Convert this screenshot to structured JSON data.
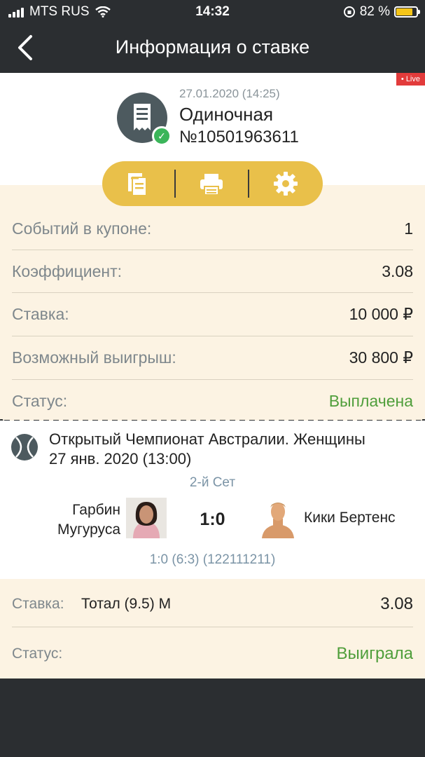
{
  "status_bar": {
    "carrier": "MTS RUS",
    "time": "14:32",
    "battery_percent": "82 %"
  },
  "navbar": {
    "back_icon": "chevron-left-icon",
    "title": "Информация о ставке"
  },
  "bet_header": {
    "live_badge": "• Live",
    "date": "27.01.2020 (14:25)",
    "type": "Одиночная",
    "number": "№10501963611",
    "icon": "receipt-icon",
    "status_icon": "check-circle-icon"
  },
  "toolbar": {
    "icons": [
      "document-copy-icon",
      "printer-icon",
      "gear-icon"
    ]
  },
  "summary": {
    "rows": [
      {
        "label": "Событий в купоне:",
        "value": "1"
      },
      {
        "label": "Коэффициент:",
        "value": "3.08"
      },
      {
        "label": "Ставка:",
        "value": "10 000 ₽"
      },
      {
        "label": "Возможный выигрыш:",
        "value": "30 800 ₽"
      },
      {
        "label": "Статус:",
        "value": "Выплачена"
      }
    ]
  },
  "event": {
    "sport_icon": "tennis-ball-icon",
    "tournament": "Открытый Чемпионат Австралии. Женщины",
    "date": "27 янв. 2020 (13:00)",
    "period": "2-й Сет",
    "team1_line1": "Гарбин",
    "team1_line2": "Мугуруса",
    "score": "1:0",
    "team2": "Кики Бертенс",
    "detail": "1:0 (6:3) (122111211)"
  },
  "bet_detail": {
    "stake_label": "Ставка:",
    "market": "Тотал (9.5) М",
    "odds": "3.08",
    "status_label": "Статус:",
    "status_value": "Выиграла"
  },
  "colors": {
    "dark": "#2b2e31",
    "accent": "#e9c04a",
    "cream": "#fcf3e3",
    "green": "#4f9e3b",
    "live_red": "#e23b3b"
  }
}
